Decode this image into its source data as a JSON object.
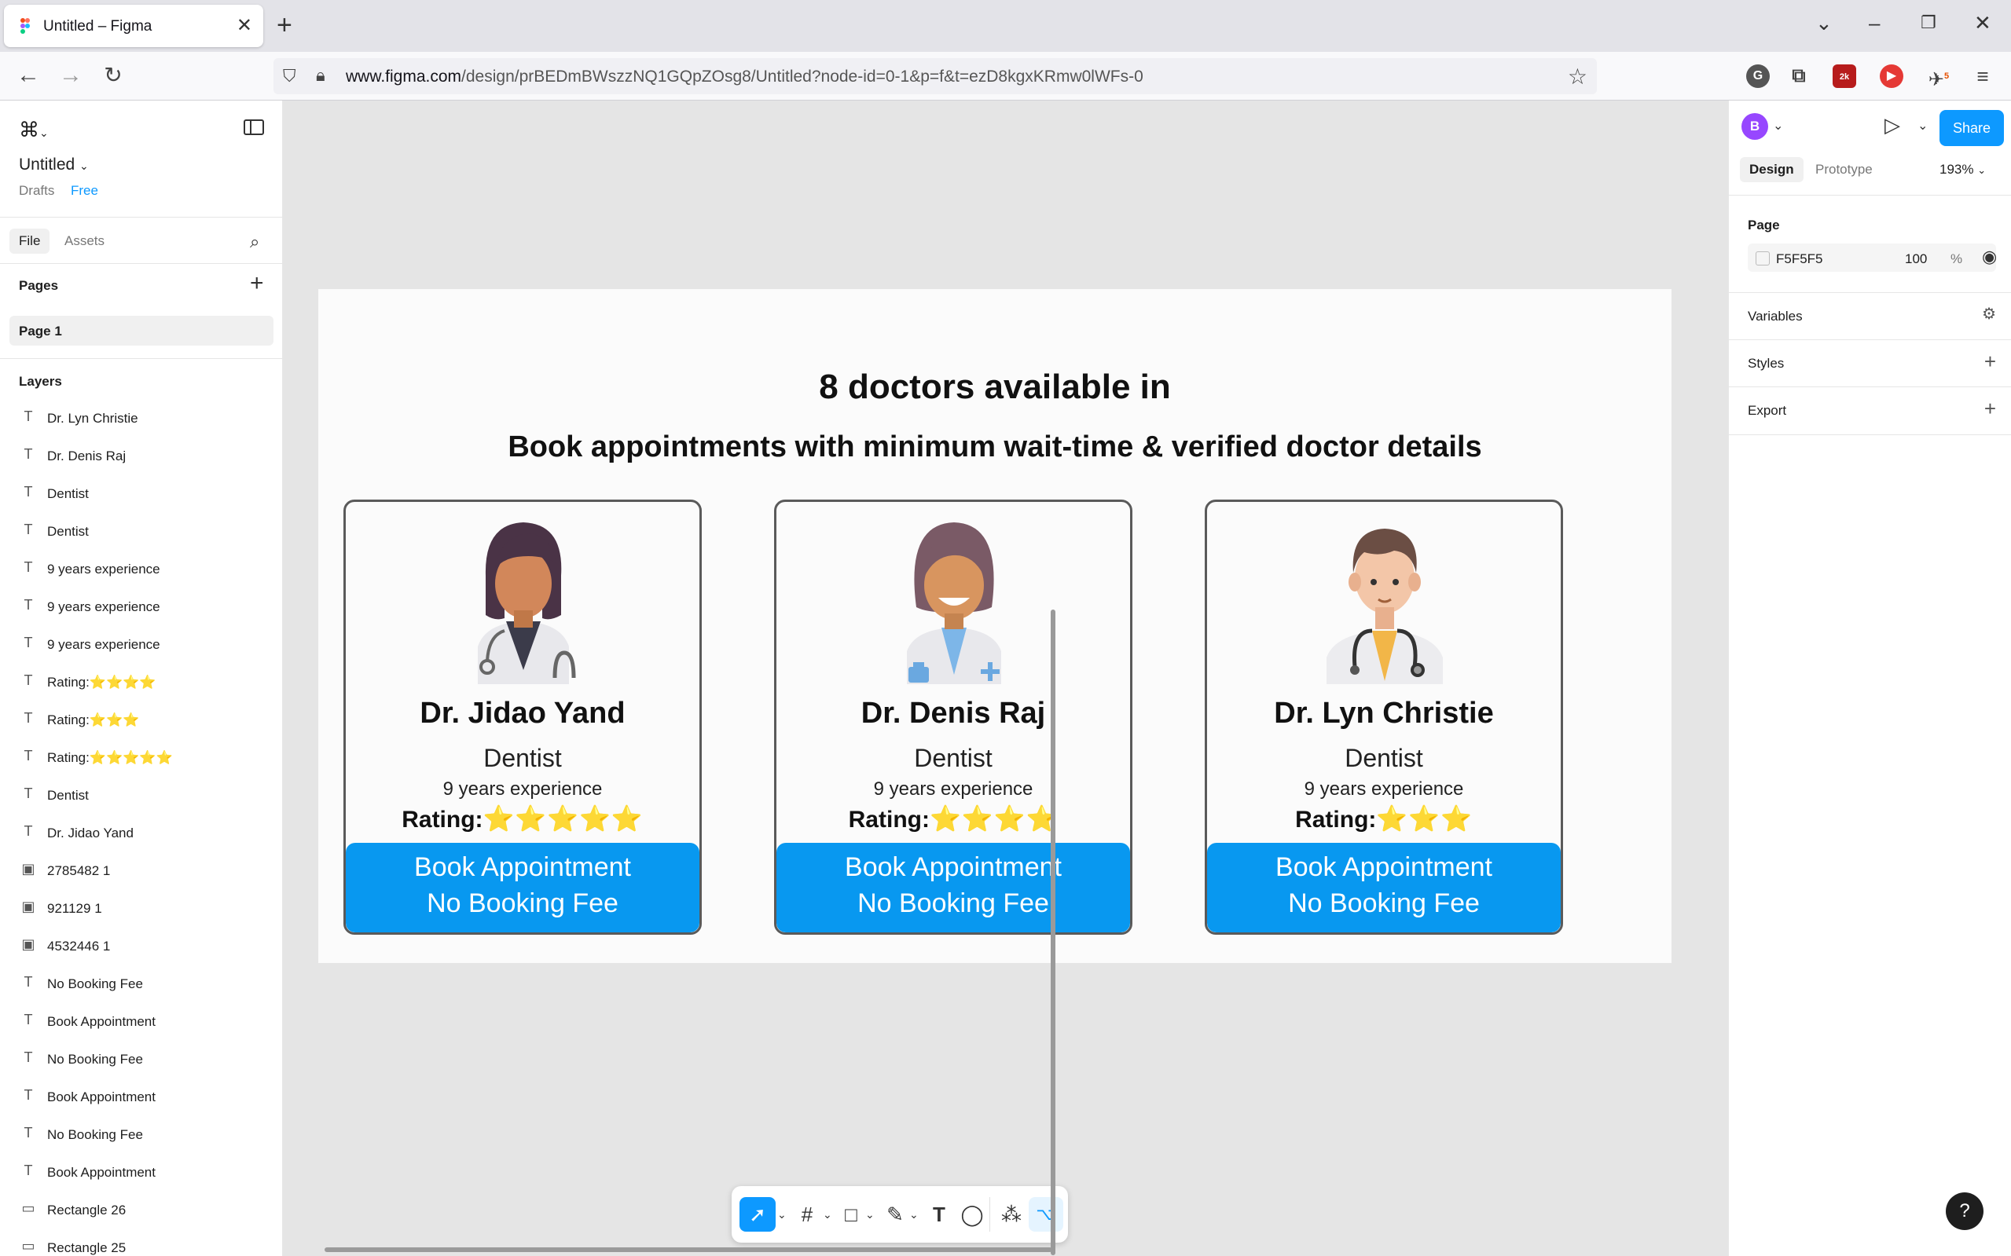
{
  "browser": {
    "tab_title": "Untitled – Figma",
    "url_domain": "www.figma.com",
    "url_path": "/design/prBEDmBWszzNQ1GQpZOsg8/Untitled?node-id=0-1&p=f&t=ezD8kgxKRmw0lWFs-0",
    "ext_badges": [
      "2k",
      "5"
    ]
  },
  "left": {
    "file_name": "Untitled",
    "drafts": "Drafts",
    "plan": "Free",
    "tab_file": "File",
    "tab_assets": "Assets",
    "pages_heading": "Pages",
    "page1": "Page 1",
    "layers_heading": "Layers",
    "layers": [
      {
        "icon": "text-icon",
        "name": "Dr. Lyn Christie"
      },
      {
        "icon": "text-icon",
        "name": "Dr. Denis Raj"
      },
      {
        "icon": "text-icon",
        "name": "Dentist"
      },
      {
        "icon": "text-icon",
        "name": "Dentist"
      },
      {
        "icon": "text-icon",
        "name": "9 years experience"
      },
      {
        "icon": "text-icon",
        "name": "9 years experience"
      },
      {
        "icon": "text-icon",
        "name": "9 years experience"
      },
      {
        "icon": "text-icon",
        "name": "Rating:⭐⭐⭐⭐"
      },
      {
        "icon": "text-icon",
        "name": "Rating:⭐⭐⭐"
      },
      {
        "icon": "text-icon",
        "name": "Rating:⭐⭐⭐⭐⭐"
      },
      {
        "icon": "text-icon",
        "name": "Dentist"
      },
      {
        "icon": "text-icon",
        "name": "Dr. Jidao Yand"
      },
      {
        "icon": "image-icon",
        "name": "2785482 1"
      },
      {
        "icon": "image-icon",
        "name": "921129 1"
      },
      {
        "icon": "image-icon",
        "name": "4532446 1"
      },
      {
        "icon": "text-icon",
        "name": "No Booking Fee"
      },
      {
        "icon": "text-icon",
        "name": "Book Appointment"
      },
      {
        "icon": "text-icon",
        "name": "No Booking Fee"
      },
      {
        "icon": "text-icon",
        "name": "Book Appointment"
      },
      {
        "icon": "text-icon",
        "name": "No Booking Fee"
      },
      {
        "icon": "text-icon",
        "name": "Book Appointment"
      },
      {
        "icon": "rectangle-icon",
        "name": "Rectangle 26"
      },
      {
        "icon": "rectangle-icon",
        "name": "Rectangle 25"
      }
    ]
  },
  "frame": {
    "title": "8 doctors available in",
    "subtitle": "Book appointments with minimum wait-time & verified doctor details",
    "cards": [
      {
        "name": "Dr. Jidao Yand",
        "specialty": "Dentist",
        "experience": "9 years experience",
        "rating_label": "Rating:",
        "stars": "⭐⭐⭐⭐⭐",
        "btn_line1": "Book Appointment",
        "btn_line2": "No Booking Fee",
        "avatar": "female-doctor-avatar"
      },
      {
        "name": "Dr. Denis Raj",
        "specialty": "Dentist",
        "experience": "9 years experience",
        "rating_label": "Rating:",
        "stars": "⭐⭐⭐⭐",
        "btn_line1": "Book Appointment",
        "btn_line2": "No Booking Fee",
        "avatar": "female-doctor-avatar"
      },
      {
        "name": "Dr. Lyn Christie",
        "specialty": "Dentist",
        "experience": "9 years experience",
        "rating_label": "Rating:",
        "stars": "⭐⭐⭐",
        "btn_line1": "Book Appointment",
        "btn_line2": "No Booking Fee",
        "avatar": "male-doctor-avatar"
      }
    ]
  },
  "right": {
    "user_initial": "B",
    "share": "Share",
    "tab_design": "Design",
    "tab_prototype": "Prototype",
    "zoom": "193%",
    "page_heading": "Page",
    "page_color": "F5F5F5",
    "page_opacity": "100",
    "page_opacity_unit": "%",
    "variables": "Variables",
    "styles": "Styles",
    "export": "Export"
  },
  "help": "?",
  "colors": {
    "accent": "#0d99ff",
    "button_blue": "#0898f0",
    "page_bg": "#F5F5F5"
  }
}
